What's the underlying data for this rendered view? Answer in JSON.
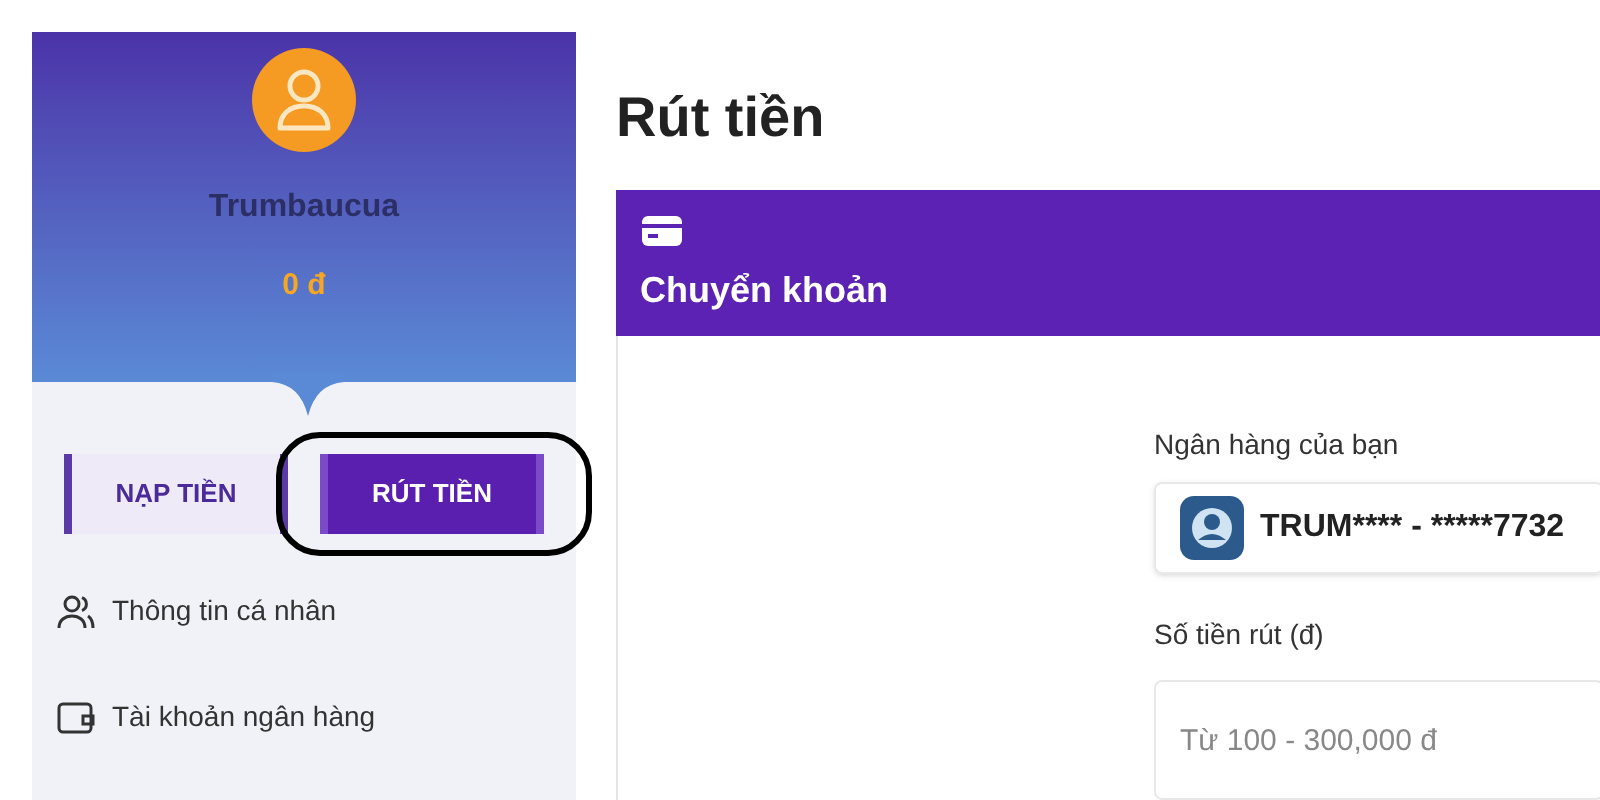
{
  "profile": {
    "username": "Trumbaucua",
    "balance": "0 đ"
  },
  "actions": [
    {
      "label": "NẠP TIỀN",
      "selected": false,
      "circled": false
    },
    {
      "label": "RÚT TIỀN",
      "selected": true,
      "circled": true
    }
  ],
  "menu": [
    {
      "label": "Thông tin cá nhân",
      "kind": "people"
    },
    {
      "label": "Tài khoản ngân hàng",
      "kind": "wallet"
    }
  ],
  "page_title": "Rút tiền",
  "method": {
    "title": "Chuyển khoản"
  },
  "form": {
    "bank_label": "Ngân hàng của bạn",
    "bank_value": "TRUM**** - *****7732",
    "amount_label": "Số tiền rút (đ)",
    "amount_placeholder": "Từ 100 - 300,000 đ"
  }
}
